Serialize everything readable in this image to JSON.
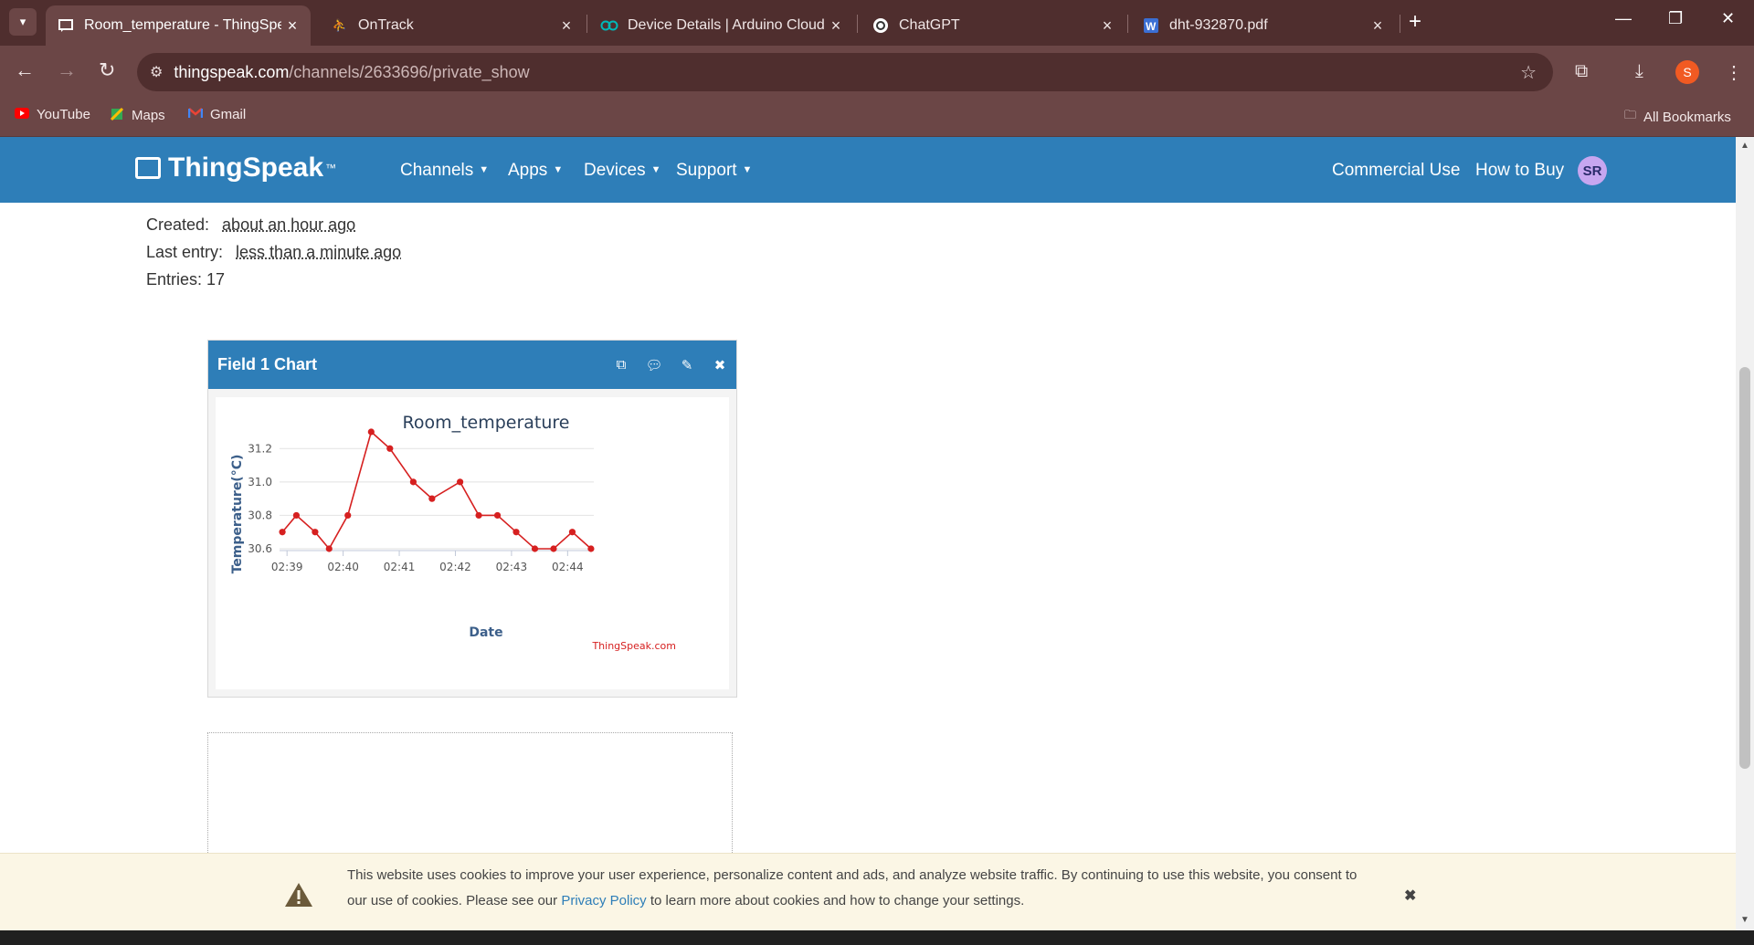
{
  "browser": {
    "tabs": [
      {
        "title": "Room_temperature - ThingSpeak",
        "icon": "thingspeak-icon",
        "active": true
      },
      {
        "title": "OnTrack",
        "icon": "ontrack-icon",
        "active": false
      },
      {
        "title": "Device Details | Arduino Cloud",
        "icon": "arduino-icon",
        "active": false
      },
      {
        "title": "ChatGPT",
        "icon": "chatgpt-icon",
        "active": false
      },
      {
        "title": "dht-932870.pdf",
        "icon": "pdf-icon",
        "active": false
      }
    ],
    "url_host": "thingspeak.com",
    "url_path": "/channels/2633696/private_show",
    "profile_initial": "S",
    "bookmarks": [
      "YouTube",
      "Maps",
      "Gmail"
    ],
    "all_bookmarks": "All Bookmarks"
  },
  "nav": {
    "logo": "ThingSpeak",
    "logo_tm": "™",
    "menus": [
      "Channels",
      "Apps",
      "Devices",
      "Support"
    ],
    "commercial": "Commercial Use",
    "how_to_buy": "How to Buy",
    "avatar": "SR"
  },
  "channel": {
    "created_label": "Created:",
    "created_value": "about an hour ago",
    "last_entry_label": "Last entry:",
    "last_entry_value": "less than a minute ago",
    "entries": "Entries: 17"
  },
  "chart_card": {
    "title": "Field 1 Chart"
  },
  "chart_data": {
    "type": "line",
    "title": "Room_temperature",
    "xlabel": "Date",
    "ylabel": "Temperature(°C)",
    "credit": "ThingSpeak.com",
    "x_ticks": [
      "02:39",
      "02:40",
      "02:41",
      "02:42",
      "02:43",
      "02:44"
    ],
    "y_ticks": [
      30.6,
      30.8,
      31.0,
      31.2
    ],
    "ylim": [
      30.6,
      31.3
    ],
    "grid": true,
    "series": [
      {
        "color": "#d62020",
        "points": [
          {
            "x": "02:38:55",
            "y": 30.7
          },
          {
            "x": "02:39:10",
            "y": 30.8
          },
          {
            "x": "02:39:30",
            "y": 30.7
          },
          {
            "x": "02:39:45",
            "y": 30.6
          },
          {
            "x": "02:40:05",
            "y": 30.8
          },
          {
            "x": "02:40:30",
            "y": 31.3
          },
          {
            "x": "02:40:50",
            "y": 31.2
          },
          {
            "x": "02:41:15",
            "y": 31.0
          },
          {
            "x": "02:41:35",
            "y": 30.9
          },
          {
            "x": "02:42:05",
            "y": 31.0
          },
          {
            "x": "02:42:25",
            "y": 30.8
          },
          {
            "x": "02:42:45",
            "y": 30.8
          },
          {
            "x": "02:43:05",
            "y": 30.7
          },
          {
            "x": "02:43:25",
            "y": 30.6
          },
          {
            "x": "02:43:45",
            "y": 30.6
          },
          {
            "x": "02:44:05",
            "y": 30.7
          },
          {
            "x": "02:44:25",
            "y": 30.6
          }
        ]
      }
    ]
  },
  "cookie": {
    "line1": "This website uses cookies to improve your user experience, personalize content and ads, and analyze website traffic. By continuing to use this website, you consent to",
    "line2_pre": "our use of cookies. Please see our ",
    "link": "Privacy Policy",
    "line2_post": " to learn more about cookies and how to change your settings."
  }
}
